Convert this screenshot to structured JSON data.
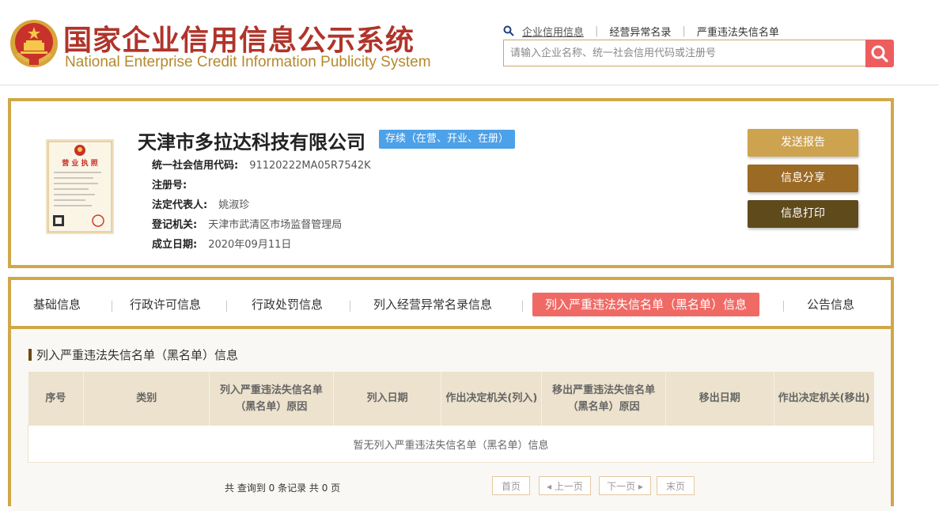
{
  "header": {
    "title_cn": "国家企业信用信息公示系统",
    "title_en": "National Enterprise Credit Information Publicity System",
    "links": [
      "企业信用信息",
      "经营异常名录",
      "严重违法失信名单"
    ],
    "search_placeholder": "请输入企业名称、统一社会信用代码或注册号"
  },
  "company": {
    "name": "天津市多拉达科技有限公司",
    "status": "存续（在营、开业、在册）",
    "license_label": "营 业 执 照",
    "fields": [
      {
        "label": "统一社会信用代码:",
        "value": "91120222MA05R7542K"
      },
      {
        "label": "注册号:",
        "value": ""
      },
      {
        "label": "法定代表人:",
        "value": "姚淑珍"
      },
      {
        "label": "登记机关:",
        "value": "天津市武清区市场监督管理局"
      },
      {
        "label": "成立日期:",
        "value": "2020年09月11日"
      }
    ]
  },
  "actions": {
    "report": "发送报告",
    "share": "信息分享",
    "print": "信息打印"
  },
  "tabs": [
    "基础信息",
    "行政许可信息",
    "行政处罚信息",
    "列入经营异常名录信息",
    "列入严重违法失信名单（黑名单）信息",
    "公告信息"
  ],
  "section": {
    "title": "列入严重违法失信名单（黑名单）信息",
    "columns": [
      "序号",
      "类别",
      "列入严重违法失信名单（黑名单）原因",
      "列入日期",
      "作出决定机关(列入)",
      "移出严重违法失信名单（黑名单）原因",
      "移出日期",
      "作出决定机关(移出)"
    ],
    "empty_text": "暂无列入严重违法失信名单（黑名单）信息"
  },
  "pagination": {
    "summary": "共 查询到 0 条记录 共 0 页",
    "first": "首页",
    "prev": "◂ 上一页",
    "next": "下一页 ▸",
    "last": "末页"
  },
  "colors": {
    "brand_red": "#b0342a",
    "gold_border": "#d0a848",
    "status_blue": "#4da1e8",
    "active_tab": "#f06a65",
    "search_button": "#ed5d5d"
  }
}
